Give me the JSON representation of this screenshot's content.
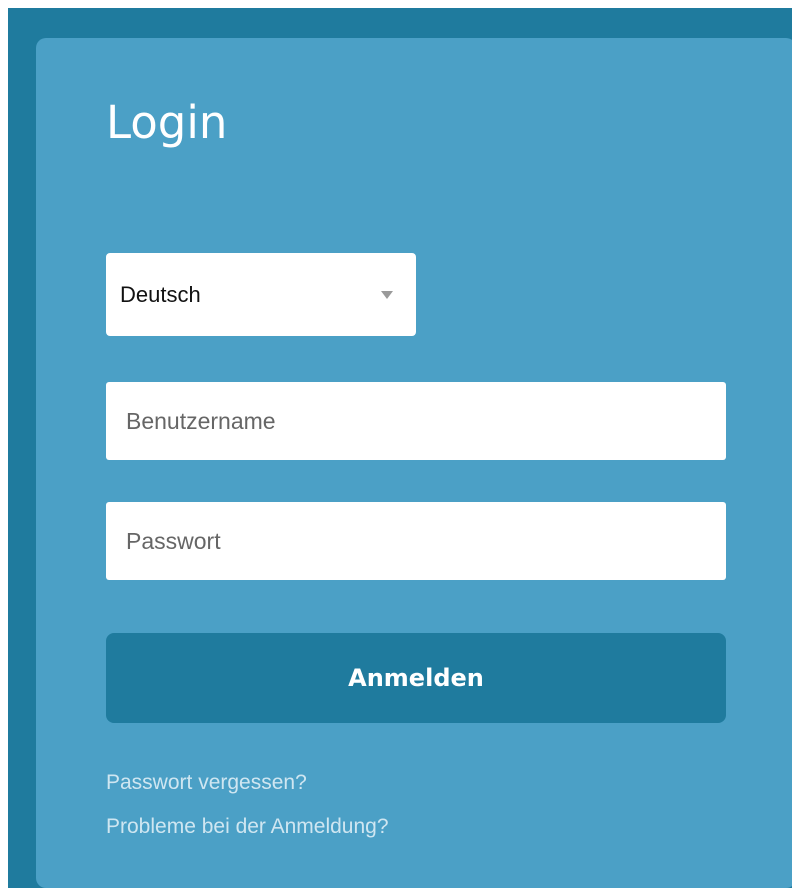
{
  "login": {
    "title": "Login",
    "language_select": {
      "selected": "Deutsch"
    },
    "username": {
      "value": "",
      "placeholder": "Benutzername"
    },
    "password": {
      "value": "",
      "placeholder": "Passwort"
    },
    "submit_label": "Anmelden",
    "links": {
      "forgot_password": "Passwort vergessen?",
      "login_problems": "Probleme bei der Anmeldung?"
    }
  },
  "icons": {
    "language_dropdown": "chevron-down-icon"
  },
  "colors": {
    "frame": "#1f7b9e",
    "panel": "#4ba0c6",
    "button": "#1f7b9e",
    "link": "#cfe6f1",
    "text_on_panel": "#ffffff"
  }
}
